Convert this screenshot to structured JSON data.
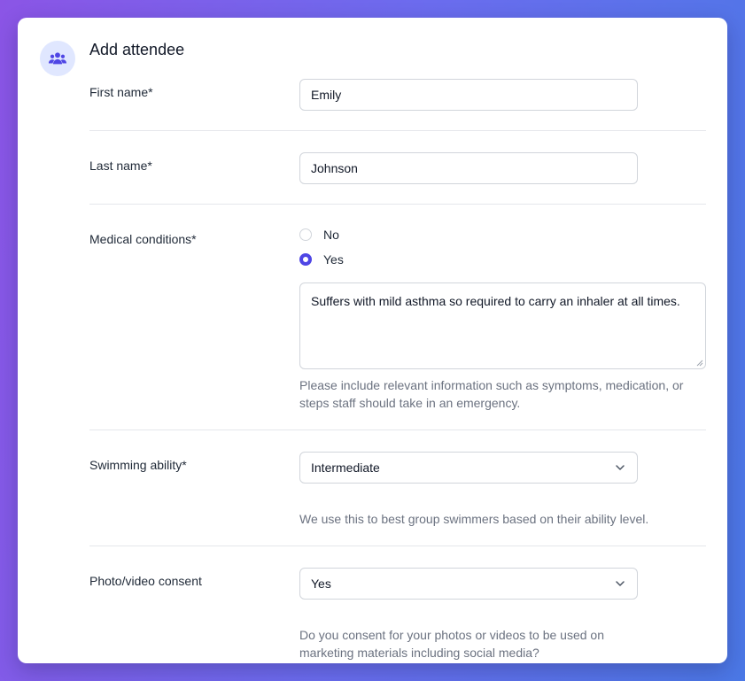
{
  "title": "Add attendee",
  "fields": {
    "first_name": {
      "label": "First name*",
      "value": "Emily"
    },
    "last_name": {
      "label": "Last name*",
      "value": "Johnson"
    },
    "medical": {
      "label": "Medical conditions*",
      "option_no": "No",
      "option_yes": "Yes",
      "selected": "Yes",
      "details": "Suffers with mild asthma so required to carry an inhaler at all times.",
      "help": "Please include relevant information such as symptoms, medication, or steps staff should take in an emergency."
    },
    "swimming": {
      "label": "Swimming ability*",
      "value": "Intermediate",
      "help": "We use this to best group swimmers based on their ability level."
    },
    "consent": {
      "label": "Photo/video consent",
      "value": "Yes",
      "help": "Do you consent for your photos or videos to be used on marketing materials including social media?"
    }
  },
  "icons": {
    "header": "users-group-icon",
    "select_arrow": "chevron-down-icon"
  },
  "colors": {
    "accent": "#4f46e5",
    "icon_bg": "#e0e7ff"
  }
}
